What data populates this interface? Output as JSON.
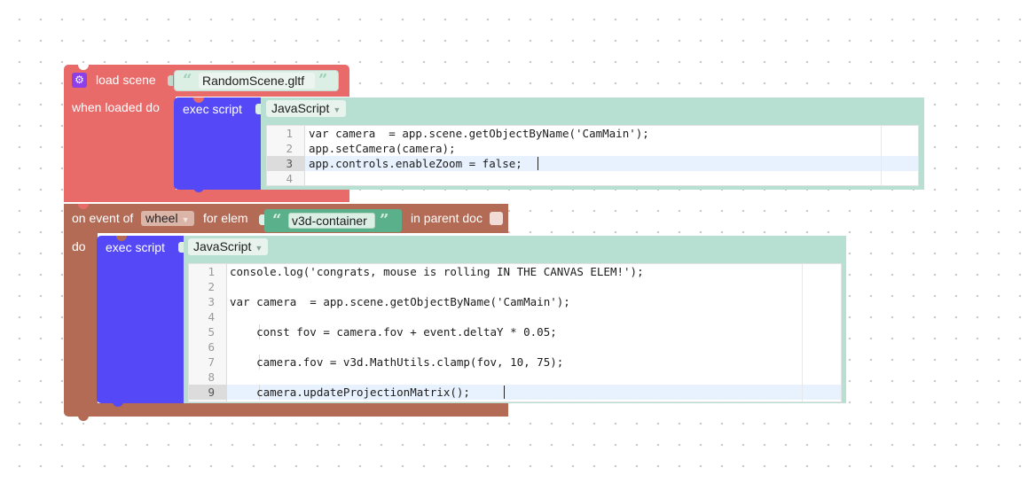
{
  "load_block": {
    "label": "load scene",
    "gear_glyph": "⚙",
    "scene_file": "RandomScene.gltf",
    "when_loaded_label": "when loaded do",
    "color": "#e86a69"
  },
  "exec_script_1": {
    "label": "exec script",
    "language": "JavaScript",
    "lines": [
      {
        "num": "1",
        "code": "var camera  = app.scene.getObjectByName('CamMain');"
      },
      {
        "num": "2",
        "code": "app.setCamera(camera);"
      },
      {
        "num": "3",
        "code": "app.controls.enableZoom = false;"
      },
      {
        "num": "4",
        "code": ""
      }
    ],
    "active_line": 3
  },
  "event_block": {
    "on_event_label": "on event of",
    "event_name": "wheel",
    "for_elem_label": "for elem",
    "elem_id": "v3d-container",
    "in_parent_doc_label": "in parent doc",
    "do_label": "do",
    "color": "#b36b55"
  },
  "exec_script_2": {
    "label": "exec script",
    "language": "JavaScript",
    "lines": [
      {
        "num": "1",
        "code": "console.log('congrats, mouse is rolling IN THE CANVAS ELEM!');"
      },
      {
        "num": "2",
        "code": ""
      },
      {
        "num": "3",
        "code": "var camera  = app.scene.getObjectByName('CamMain');"
      },
      {
        "num": "4",
        "code": ""
      },
      {
        "num": "5",
        "code": "    const fov = camera.fov + event.deltaY * 0.05;"
      },
      {
        "num": "6",
        "code": ""
      },
      {
        "num": "7",
        "code": "    camera.fov = v3d.MathUtils.clamp(fov, 10, 75);"
      },
      {
        "num": "8",
        "code": ""
      },
      {
        "num": "9",
        "code": "    camera.updateProjectionMatrix();"
      }
    ],
    "active_line": 9
  },
  "icons": {
    "quote_open": "“",
    "quote_close": "”",
    "caret": "▼"
  },
  "colors": {
    "exec_purple": "#5549f7",
    "panel_green": "#b8e0d2",
    "string_green": "#5ab08a"
  }
}
